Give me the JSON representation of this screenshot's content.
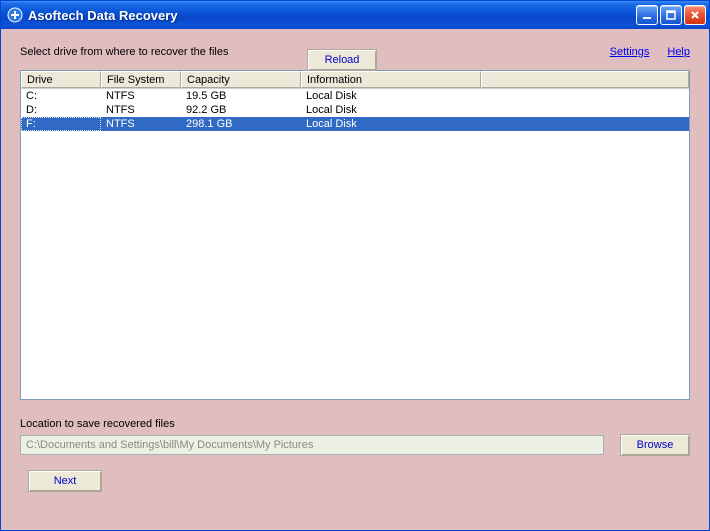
{
  "window": {
    "title": "Asoftech Data Recovery"
  },
  "top": {
    "instruction": "Select drive from where to recover the files",
    "reload_label": "Reload",
    "settings_label": "Settings",
    "help_label": "Help"
  },
  "columns": {
    "drive": "Drive",
    "filesystem": "File System",
    "capacity": "Capacity",
    "information": "Information"
  },
  "drives": [
    {
      "letter": "C:",
      "fs": "NTFS",
      "capacity": "19.5 GB",
      "info": "Local Disk",
      "selected": false
    },
    {
      "letter": "D:",
      "fs": "NTFS",
      "capacity": "92.2 GB",
      "info": "Local Disk",
      "selected": false
    },
    {
      "letter": "F:",
      "fs": "NTFS",
      "capacity": "298.1 GB",
      "info": "Local Disk",
      "selected": true
    }
  ],
  "location": {
    "label": "Location to save recovered files",
    "path": "C:\\Documents and Settings\\bill\\My Documents\\My Pictures",
    "browse_label": "Browse"
  },
  "footer": {
    "next_label": "Next"
  }
}
